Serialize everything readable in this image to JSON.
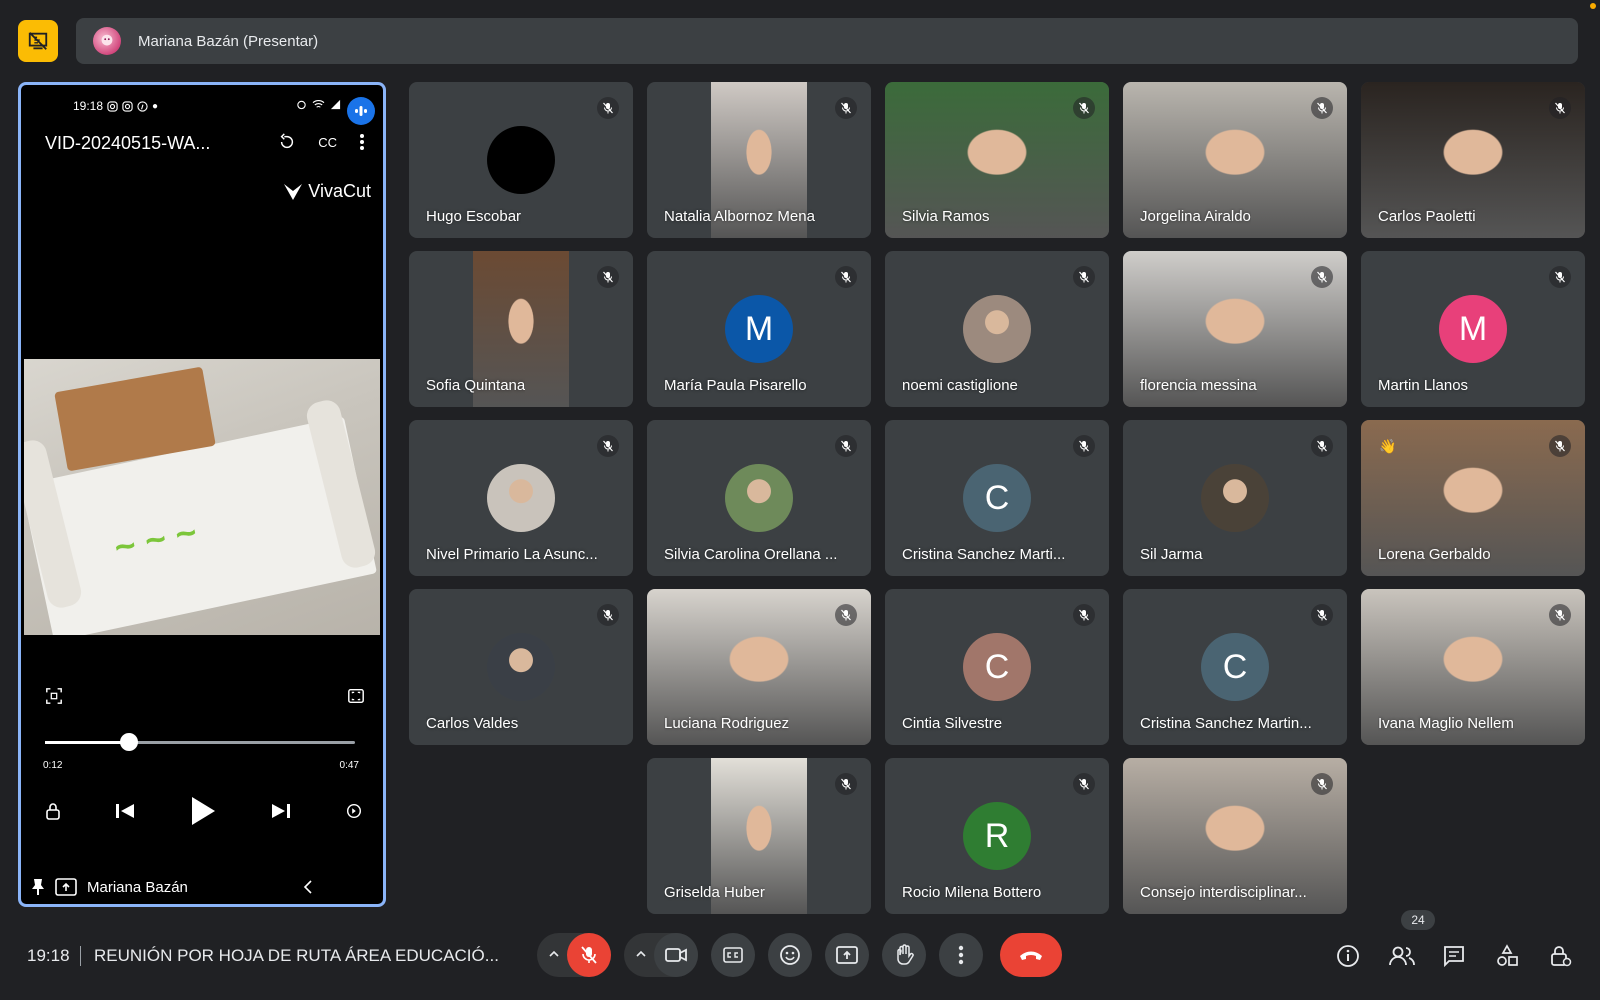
{
  "presenter_bar": {
    "label": "Mariana Bazán (Presentar)"
  },
  "presentation": {
    "phone_time": "19:18",
    "video_title": "VID-20240515-WA...",
    "cc_label": "CC",
    "watermark": "VivaCut",
    "time_current": "0:12",
    "time_total": "0:47",
    "progress_fraction": 0.27,
    "presenter_name": "Mariana Bazán"
  },
  "participants": [
    {
      "name": "Hugo Escobar",
      "kind": "avatar",
      "initial": "",
      "color": "#000000"
    },
    {
      "name": "Natalia Albornoz Mena",
      "kind": "video",
      "color": "#cfc9c4"
    },
    {
      "name": "Silvia Ramos",
      "kind": "video",
      "color": "#3b6b3a"
    },
    {
      "name": "Jorgelina Airaldo",
      "kind": "video",
      "color": "#b9b5ae"
    },
    {
      "name": "Carlos Paoletti",
      "kind": "video",
      "color": "#2a2420"
    },
    {
      "name": "Sofia Quintana",
      "kind": "video",
      "color": "#6b4a33"
    },
    {
      "name": "María Paula Pisarello",
      "kind": "avatar",
      "initial": "M",
      "color": "#0b57a8"
    },
    {
      "name": "noemi castiglione",
      "kind": "avatar-photo",
      "initial": "",
      "color": "#9c8a7e"
    },
    {
      "name": "florencia messina",
      "kind": "video",
      "color": "#cfcdca"
    },
    {
      "name": "Martin Llanos",
      "kind": "avatar",
      "initial": "M",
      "color": "#e8407a"
    },
    {
      "name": "Nivel Primario La Asunc...",
      "kind": "avatar-photo",
      "initial": "",
      "color": "#c9c3bb"
    },
    {
      "name": "Silvia Carolina Orellana ...",
      "kind": "avatar-photo",
      "initial": "",
      "color": "#6e8a5a"
    },
    {
      "name": "Cristina Sanchez Marti...",
      "kind": "avatar",
      "initial": "C",
      "color": "#4a6472"
    },
    {
      "name": "Sil Jarma",
      "kind": "avatar-photo",
      "initial": "",
      "color": "#4a4238"
    },
    {
      "name": "Lorena Gerbaldo",
      "kind": "video",
      "color": "#8a6a4f"
    },
    {
      "name": "Carlos Valdes",
      "kind": "avatar-photo",
      "initial": "",
      "color": "#3a3f46"
    },
    {
      "name": "Luciana Rodriguez",
      "kind": "video",
      "color": "#d7d3cd"
    },
    {
      "name": "Cintia Silvestre",
      "kind": "avatar",
      "initial": "C",
      "color": "#a1766a"
    },
    {
      "name": "Cristina Sanchez Martin...",
      "kind": "avatar",
      "initial": "C",
      "color": "#4a6472"
    },
    {
      "name": "Ivana Maglio Nellem",
      "kind": "video",
      "color": "#c9c4bd"
    },
    {
      "name": "Griselda Huber",
      "kind": "video",
      "color": "#e2dfd8"
    },
    {
      "name": "Rocio Milena Bottero",
      "kind": "avatar",
      "initial": "R",
      "color": "#2f7d32"
    },
    {
      "name": "Consejo interdisciplinar...",
      "kind": "video",
      "color": "#b7aea4"
    }
  ],
  "bottom_bar": {
    "time": "19:18",
    "meeting_title": "REUNIÓN POR HOJA DE RUTA ÁREA EDUCACIÓ...",
    "people_count": "24"
  },
  "colors": {
    "background": "#202124",
    "tile": "#3c4043",
    "present_accent": "#fbbc04",
    "active_border": "#8ab4f8",
    "danger": "#ea4335"
  }
}
